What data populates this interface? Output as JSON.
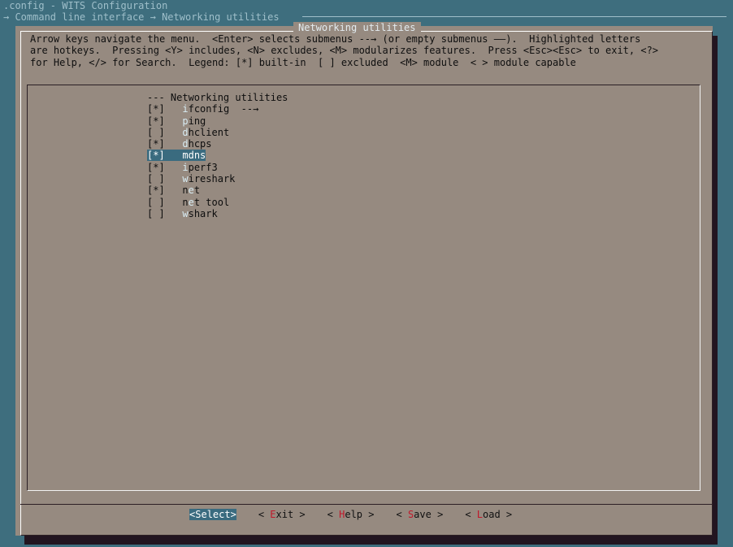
{
  "window": {
    "title": ".config - WITS Configuration",
    "breadcrumb": "→ Command line interface → Networking utilities"
  },
  "dialog": {
    "title": "Networking utilities",
    "help_lines": [
      "Arrow keys navigate the menu.  <Enter> selects submenus --→ (or empty submenus ——).  Highlighted letters",
      "are hotkeys.  Pressing <Y> includes, <N> excludes, <M> modularizes features.  Press <Esc><Esc> to exit, <?>",
      "for Help, </> for Search.  Legend: [*] built-in  [ ] excluded  <M> module  < > module capable"
    ]
  },
  "menu": {
    "header": "--- Networking utilities",
    "items": [
      {
        "state": "[*]",
        "hotkey": "i",
        "rest": "fconfig  --→",
        "selected": false
      },
      {
        "state": "[*]",
        "hotkey": "p",
        "rest": "ing",
        "selected": false
      },
      {
        "state": "[ ]",
        "hotkey": "d",
        "rest": "hclient",
        "selected": false
      },
      {
        "state": "[*]",
        "hotkey": "d",
        "rest": "hcps",
        "selected": false
      },
      {
        "state": "[*]",
        "hotkey": "m",
        "rest": "dns",
        "selected": true
      },
      {
        "state": "[*]",
        "hotkey": "i",
        "rest": "perf3",
        "selected": false
      },
      {
        "state": "[ ]",
        "hotkey": "w",
        "rest": "ireshark",
        "selected": false
      },
      {
        "state": "[*]",
        "prefix": "n",
        "hotkey": "e",
        "rest": "t",
        "selected": false
      },
      {
        "state": "[ ]",
        "prefix": "n",
        "hotkey": "e",
        "rest": "t tool",
        "selected": false
      },
      {
        "state": "[ ]",
        "hotkey": "w",
        "rest": "shark",
        "selected": false
      }
    ]
  },
  "buttons": [
    {
      "name": "select-button",
      "open": "<",
      "hotkey": "S",
      "rest": "elect",
      "close": ">",
      "active": true
    },
    {
      "name": "exit-button",
      "open": "< ",
      "hotkey": "E",
      "rest": "xit",
      "close": " >",
      "active": false
    },
    {
      "name": "help-button",
      "open": "< ",
      "hotkey": "H",
      "rest": "elp",
      "close": " >",
      "active": false
    },
    {
      "name": "save-button",
      "open": "< ",
      "hotkey": "S",
      "rest": "ave",
      "close": " >",
      "active": false
    },
    {
      "name": "load-button",
      "open": "< ",
      "hotkey": "L",
      "rest": "oad",
      "close": " >",
      "active": false
    }
  ]
}
